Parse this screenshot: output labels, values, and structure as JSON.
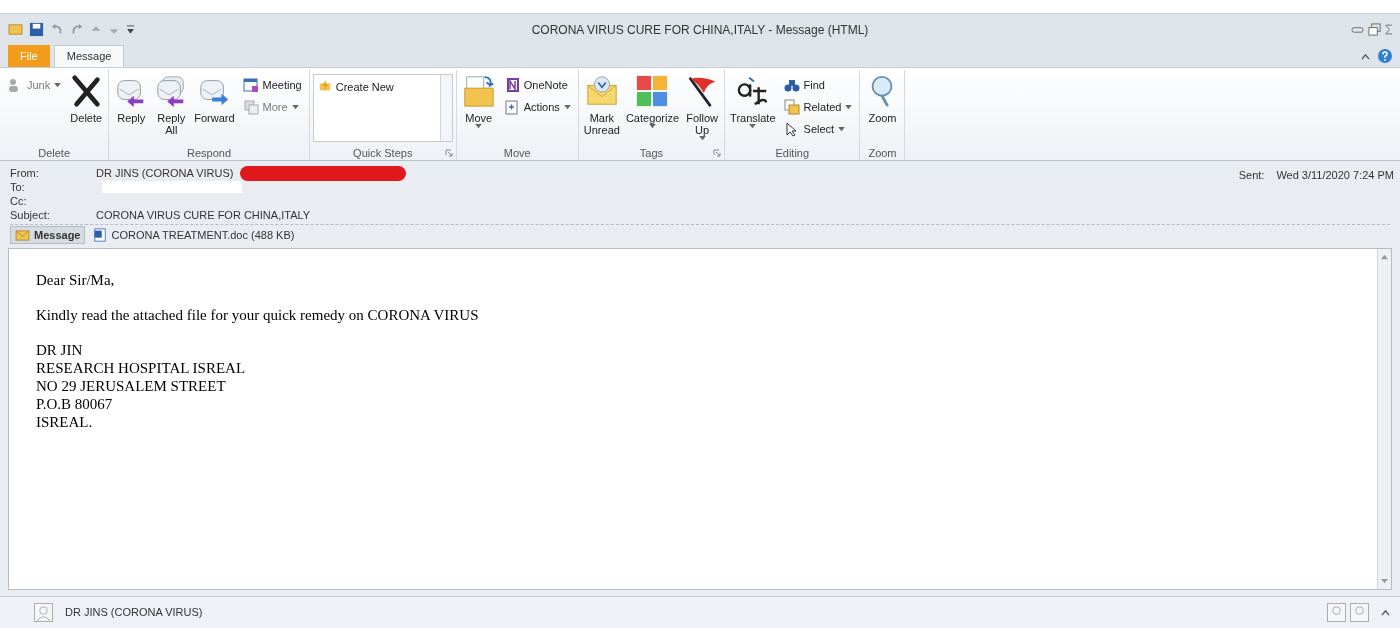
{
  "window": {
    "title": "CORONA VIRUS CURE FOR CHINA,ITALY - Message (HTML)"
  },
  "tabs": [
    {
      "label": "File",
      "kind": "file",
      "selected": false
    },
    {
      "label": "Message",
      "kind": "normal",
      "selected": true
    }
  ],
  "ribbon": {
    "groups": [
      {
        "label": "Delete",
        "items": [
          {
            "kind": "small",
            "label": "Junk",
            "disabled": true,
            "dropdown": true
          },
          {
            "kind": "large",
            "label": "Delete",
            "disabled": false,
            "dropdown": false
          }
        ]
      },
      {
        "label": "Respond",
        "items": [
          {
            "kind": "large",
            "label": "Reply",
            "disabled": false,
            "dropdown": false
          },
          {
            "kind": "large",
            "label": "Reply\nAll",
            "disabled": false,
            "dropdown": false
          },
          {
            "kind": "large",
            "label": "Forward",
            "disabled": false,
            "dropdown": false
          },
          {
            "kind": "small",
            "label": "Meeting",
            "disabled": false,
            "dropdown": false
          },
          {
            "kind": "small",
            "label": "More",
            "disabled": true,
            "dropdown": true
          }
        ]
      },
      {
        "label": "Quick Steps",
        "launcher": true,
        "items": [
          {
            "kind": "gallery",
            "label": "Create New"
          }
        ]
      },
      {
        "label": "Move",
        "items": [
          {
            "kind": "large",
            "label": "Move",
            "disabled": false,
            "dropdown": true
          },
          {
            "kind": "small",
            "label": "OneNote",
            "disabled": false,
            "dropdown": false
          },
          {
            "kind": "small",
            "label": "Actions",
            "disabled": false,
            "dropdown": true
          }
        ]
      },
      {
        "label": "Tags",
        "launcher": true,
        "items": [
          {
            "kind": "large",
            "label": "Mark\nUnread",
            "disabled": false,
            "dropdown": false
          },
          {
            "kind": "large",
            "label": "Categorize",
            "disabled": false,
            "dropdown": true
          },
          {
            "kind": "large",
            "label": "Follow\nUp",
            "disabled": false,
            "dropdown": true
          }
        ]
      },
      {
        "label": "Editing",
        "items": [
          {
            "kind": "large",
            "label": "Translate",
            "disabled": false,
            "dropdown": true
          },
          {
            "kind": "small",
            "label": "Find",
            "disabled": false,
            "dropdown": false
          },
          {
            "kind": "small",
            "label": "Related",
            "disabled": false,
            "dropdown": true
          },
          {
            "kind": "small",
            "label": "Select",
            "disabled": false,
            "dropdown": true
          }
        ]
      },
      {
        "label": "Zoom",
        "items": [
          {
            "kind": "large",
            "label": "Zoom",
            "disabled": false,
            "dropdown": false
          }
        ]
      }
    ]
  },
  "header": {
    "fields": [
      {
        "label": "From:",
        "value": "DR JINS (CORONA VIRUS)",
        "redaction": {
          "color": "#e0171c"
        }
      },
      {
        "label": "To:",
        "redaction": {
          "color": "#ffffff"
        }
      },
      {
        "label": "Cc:"
      },
      {
        "label": "Subject:",
        "value": "CORONA VIRUS CURE FOR CHINA,ITALY"
      }
    ],
    "sent": {
      "label": "Sent:",
      "value": "Wed 3/11/2020 7:24 PM"
    }
  },
  "attachments": [
    {
      "kind": "message",
      "label": "Message",
      "selected": true
    },
    {
      "kind": "doc",
      "label": "CORONA TREATMENT.doc (488 KB)",
      "selected": false
    }
  ],
  "body": {
    "paragraphs": [
      [
        "Dear Sir/Ma,"
      ],
      [
        "Kindly read the attached file for your quick remedy on CORONA VIRUS"
      ],
      [
        "DR JIN",
        "RESEARCH HOSPITAL ISREAL",
        "NO 29 JERUSALEM STREET",
        "P.O.B 80067",
        "ISREAL."
      ]
    ]
  },
  "people_pane": {
    "name": "DR JINS (CORONA VIRUS)"
  }
}
